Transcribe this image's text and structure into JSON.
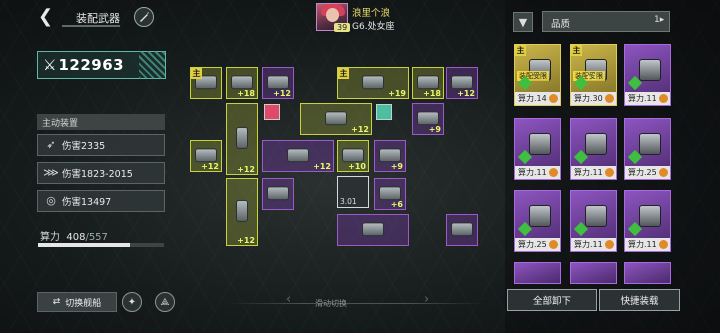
{
  "header": {
    "title": "装配武器",
    "back_icon": "chevron-left-icon",
    "rename_icon": "brush-icon"
  },
  "player": {
    "name": "浪里个浪",
    "rank": "G6.处女座",
    "level": "39"
  },
  "power": {
    "icon": "crossed-swords-icon",
    "value": "122963"
  },
  "active_section": {
    "title": "主动装置",
    "stats": [
      {
        "icon": "missile-icon",
        "label": "伤害2335"
      },
      {
        "icon": "rocket-pod-icon",
        "label": "伤害1823-2015"
      },
      {
        "icon": "target-icon",
        "label": "伤害13497"
      }
    ]
  },
  "capacity": {
    "label": "算力",
    "current": "408",
    "max": "/557",
    "fraction": 0.7325
  },
  "bottom": {
    "switch_ship": "切换舰船",
    "slide_hint": "滑动切换"
  },
  "grid": {
    "main_tag": "主",
    "tiles": [
      {
        "color": "y",
        "plus": "",
        "mark": true
      },
      {
        "color": "y",
        "plus": "+18"
      },
      {
        "color": "p",
        "plus": "+12"
      },
      {
        "color": "y",
        "plus": "+19",
        "mark": true
      },
      {
        "color": "y",
        "plus": "+18"
      },
      {
        "color": "p",
        "plus": "+12"
      },
      {
        "color": "y",
        "plus": "+12"
      },
      {
        "color": "y",
        "plus": "+12"
      },
      {
        "color": "p",
        "plus": "+9"
      },
      {
        "color": "y",
        "plus": "+12"
      },
      {
        "color": "p",
        "plus": "+12"
      },
      {
        "color": "y",
        "plus": "+10"
      },
      {
        "color": "p",
        "plus": "+9"
      },
      {
        "color": "y",
        "plus": "+12"
      },
      {
        "color": "p",
        "plus": ""
      },
      {
        "color": "p",
        "plus": "+6"
      },
      {
        "color": "p",
        "plus": ""
      },
      {
        "color": "p",
        "plus": ""
      }
    ],
    "slot_value": "3.01"
  },
  "panel": {
    "filter_icon": "funnel-icon",
    "quality_label": "品质",
    "sort_icon": "sort-icon",
    "cards": [
      {
        "color": "gold",
        "power": "算力.14",
        "tag": "主",
        "warn": "装配受限",
        "count": ""
      },
      {
        "color": "gold",
        "power": "算力.30",
        "tag": "主",
        "warn": "装配受限",
        "count": "+3"
      },
      {
        "color": "pur",
        "power": "算力.11",
        "tag": "",
        "warn": "",
        "count": ""
      },
      {
        "color": "pur",
        "power": "算力.11",
        "tag": "",
        "warn": "",
        "count": ""
      },
      {
        "color": "pur",
        "power": "算力.11",
        "tag": "",
        "warn": "",
        "count": ""
      },
      {
        "color": "pur",
        "power": "算力.25",
        "tag": "",
        "warn": "",
        "count": ""
      },
      {
        "color": "pur",
        "power": "算力.25",
        "tag": "",
        "warn": "",
        "count": ""
      },
      {
        "color": "pur",
        "power": "算力.11",
        "tag": "",
        "warn": "",
        "count": ""
      },
      {
        "color": "pur",
        "power": "算力.11",
        "tag": "",
        "warn": "",
        "count": ""
      }
    ],
    "unload_all": "全部卸下",
    "quick_equip": "快捷装载"
  }
}
